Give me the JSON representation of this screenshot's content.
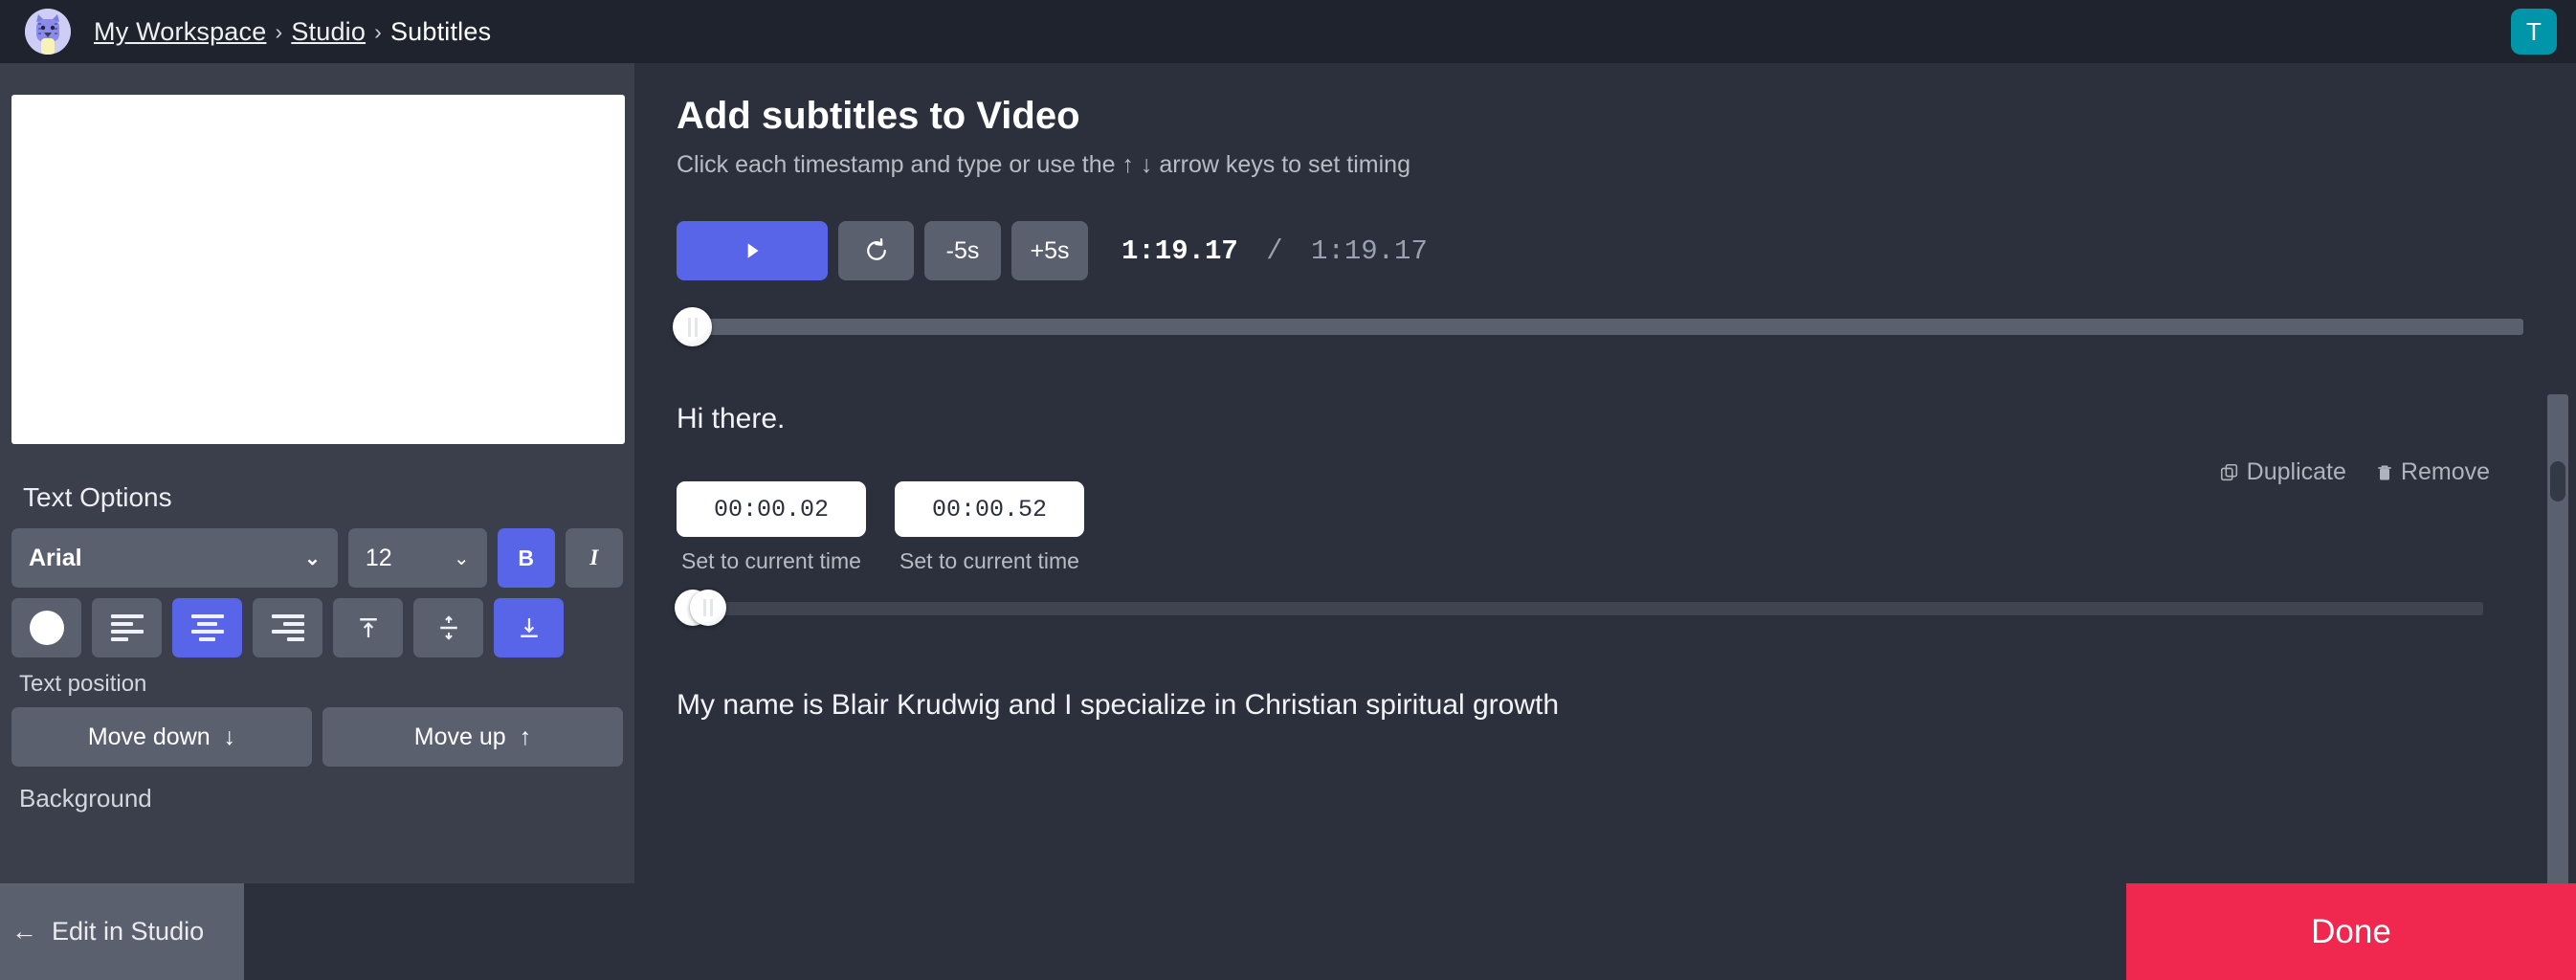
{
  "header": {
    "workspace_avatar_icon": "cat-avatar-icon",
    "breadcrumb": {
      "workspace": "My Workspace",
      "separator": "›",
      "studio": "Studio",
      "current": "Subtitles"
    },
    "user_avatar_initial": "T",
    "user_avatar_color": "#0095a8"
  },
  "sidebar": {
    "text_options_title": "Text Options",
    "font": {
      "value": "Arial",
      "chevron_icon": "chevron-down-icon"
    },
    "font_size": {
      "value": "12",
      "chevron_icon": "chevron-down-icon"
    },
    "bold_label": "B",
    "italic_label": "I",
    "color_swatch_value": "#ffffff",
    "align_buttons": [
      {
        "name": "align-left",
        "active": false
      },
      {
        "name": "align-center",
        "active": true
      },
      {
        "name": "align-right",
        "active": false
      }
    ],
    "valign_buttons": [
      {
        "name": "align-top",
        "label": "⊤",
        "active": false
      },
      {
        "name": "align-middle",
        "label": "÷",
        "active": false
      },
      {
        "name": "align-bottom",
        "label": "⊥",
        "active": true
      }
    ],
    "text_position_label": "Text position",
    "move_down_label": "Move down",
    "move_down_icon": "arrow-down-icon",
    "move_up_label": "Move up",
    "move_up_icon": "arrow-up-icon",
    "background_label": "Background"
  },
  "main": {
    "title": "Add subtitles to Video",
    "subtitle": "Click each timestamp and type or use the ↑ ↓ arrow keys to set timing",
    "player": {
      "play_icon": "play-icon",
      "restart_icon": "restart-icon",
      "back5_label": "-5s",
      "forward5_label": "+5s",
      "current_time": "1:19.17",
      "time_separator": "/",
      "total_time": "1:19.17"
    },
    "subtitles": [
      {
        "text": "Hi there.",
        "start": "00:00.02",
        "end": "00:00.52",
        "start_hint": "Set to current time",
        "end_hint": "Set to current time",
        "duplicate_label": "Duplicate",
        "duplicate_icon": "copy-icon",
        "remove_label": "Remove",
        "remove_icon": "trash-icon"
      },
      {
        "text": "My name is Blair Krudwig and I specialize in Christian spiritual growth"
      }
    ]
  },
  "footer": {
    "edit_in_studio_label": "Edit in Studio",
    "back_arrow_icon": "arrow-left-icon",
    "done_label": "Done",
    "done_color": "#f0274e"
  }
}
